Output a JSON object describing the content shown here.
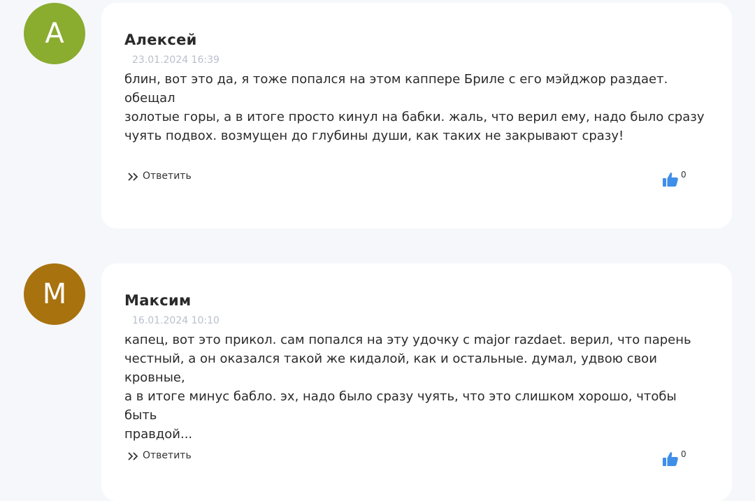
{
  "comments": [
    {
      "avatar_letter": "А",
      "avatar_color": "#8aac2f",
      "author": "Алексей",
      "date": "23.01.2024 16:39",
      "text_lines": [
        "блин, вот это да, я тоже попался на этом каппере Бриле с его мэйджор раздает. обещал",
        "золотые горы, а в итоге просто кинул на бабки. жаль, что верил ему, надо было сразу",
        "чуять подвох. возмущен до глубины души, как таких не закрывают сразу!"
      ],
      "reply_label": "Ответить",
      "likes": "0"
    },
    {
      "avatar_letter": "М",
      "avatar_color": "#a8720e",
      "author": "Максим",
      "date": "16.01.2024 10:10",
      "text_lines": [
        "капец, вот это прикол. сам попался на эту удочку с major razdaet. верил, что парень",
        "честный, а он оказался такой же кидалой, как и остальные. думал, удвою свои кровные,",
        "а в итоге минус бабло. эх, надо было сразу чуять, что это слишком хорошо, чтобы быть",
        "правдой..."
      ],
      "reply_label": "Ответить",
      "likes": "0"
    }
  ],
  "icons": {
    "reply": "double-chevron-right-icon",
    "like": "thumbs-up-icon"
  },
  "colors": {
    "page_background": "#f6f7fb",
    "card_background": "#ffffff",
    "like_icon": "#3f8ee8",
    "date_text": "#b9bfcc"
  }
}
